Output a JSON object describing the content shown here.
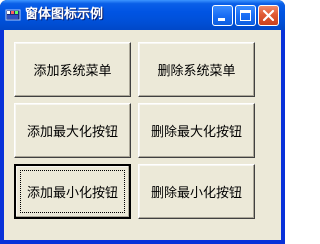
{
  "window": {
    "title": "窗体图标示例",
    "icon": "form-icon",
    "accent_color": "#0054e3",
    "close_color": "#e05a33",
    "client_color": "#ece9d8"
  },
  "controls": {
    "minimize_icon": "minimize-icon",
    "maximize_icon": "maximize-icon",
    "close_icon": "close-icon"
  },
  "buttons": [
    {
      "label": "添加系统菜单"
    },
    {
      "label": "删除系统菜单"
    },
    {
      "label": "添加最大化按钮"
    },
    {
      "label": "删除最大化按钮"
    },
    {
      "label": "添加最小化按钮",
      "focused": true
    },
    {
      "label": "删除最小化按钮"
    }
  ]
}
